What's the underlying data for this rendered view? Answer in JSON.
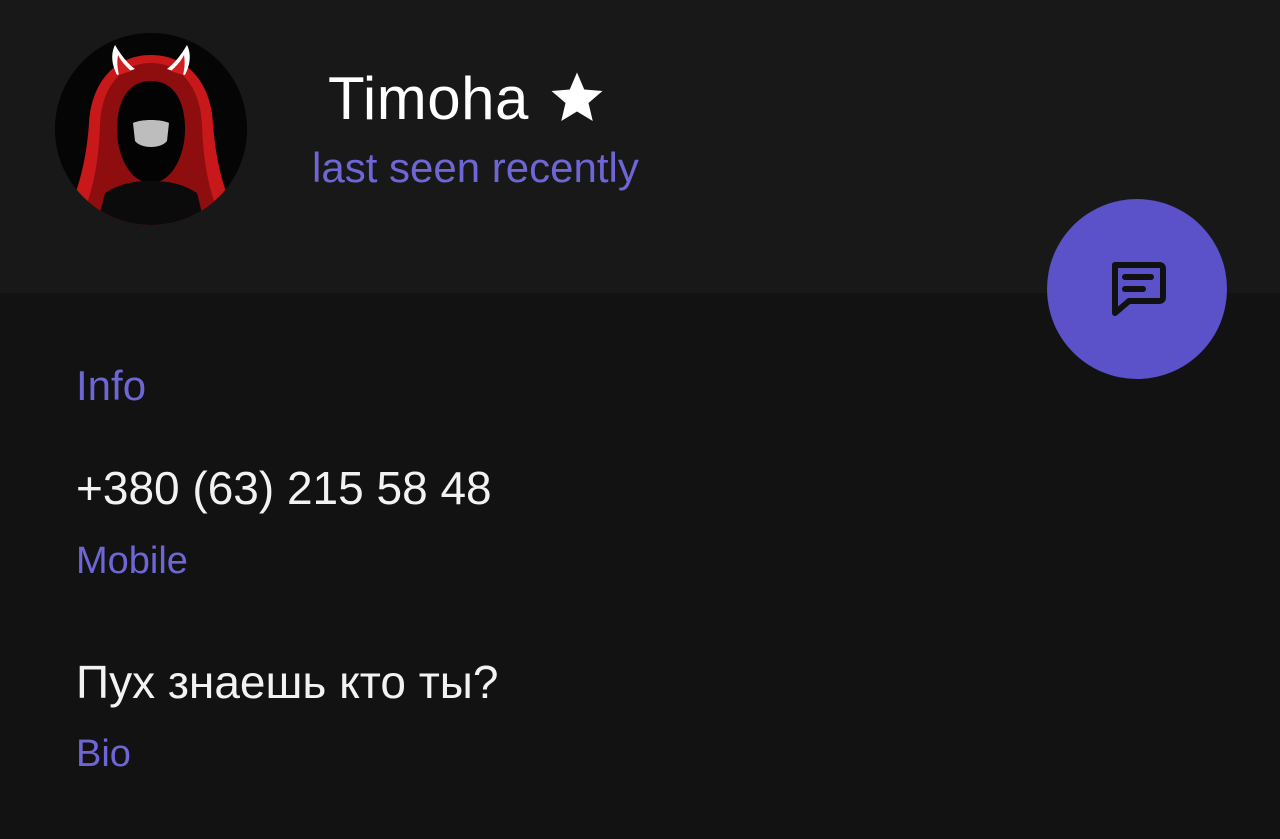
{
  "profile": {
    "name": "Timoha",
    "status": "last seen recently",
    "avatar": "hooded-devil-avatar",
    "star_icon": "star-icon"
  },
  "fab": {
    "icon": "message-icon",
    "color": "#5b51c9"
  },
  "info": {
    "title": "Info",
    "phone": {
      "value": "+380 (63) 215 58 48",
      "label": "Mobile"
    },
    "bio": {
      "value": "Пух знаешь кто ты?",
      "label": "Bio"
    }
  },
  "colors": {
    "accent": "#6f66d6",
    "background": "#121212",
    "header": "#181818"
  }
}
